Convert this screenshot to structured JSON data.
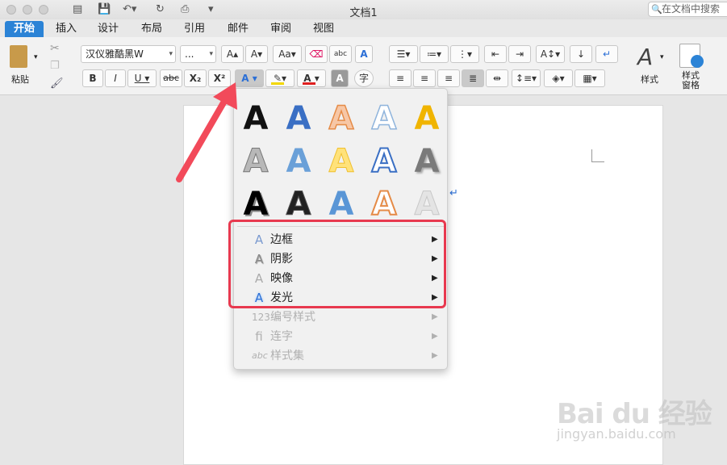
{
  "window": {
    "title": "文档1",
    "search_placeholder": "在文档中搜索"
  },
  "tabs": [
    "开始",
    "插入",
    "设计",
    "布局",
    "引用",
    "邮件",
    "审阅",
    "视图"
  ],
  "ribbon": {
    "paste_label": "粘贴",
    "font_name": "汉仪雅酷黑W",
    "font_size": "...",
    "bold": "B",
    "italic": "I",
    "underline": "U",
    "strikethrough": "abc",
    "subscript": "X₂",
    "superscript": "X²",
    "change_case": "Aa",
    "phonetic": "abc",
    "text_effects_icon": "A",
    "styles_label": "样式",
    "styles_pane_label": "样式\n窗格",
    "highlight_color": "#f5d800",
    "font_color": "#e02020",
    "accent": "#2b83d6"
  },
  "text_effects_menu": {
    "styles_grid_letter": "A",
    "items": [
      {
        "icon": "outline-icon",
        "label": "边框",
        "enabled": true
      },
      {
        "icon": "shadow-icon",
        "label": "阴影",
        "enabled": true
      },
      {
        "icon": "reflection-icon",
        "label": "映像",
        "enabled": true
      },
      {
        "icon": "glow-icon",
        "label": "发光",
        "enabled": true
      },
      {
        "icon": "number-style-icon",
        "label": "编号样式",
        "enabled": false
      },
      {
        "icon": "ligature-icon",
        "label": "连字",
        "enabled": false
      },
      {
        "icon": "stylistic-set-icon",
        "label": "样式集",
        "enabled": false
      }
    ],
    "highlight_border_color": "#e8394f"
  },
  "annotation": {
    "arrow_color": "#f24a5a"
  },
  "watermark": {
    "brand": "Bai du 经验",
    "url": "jingyan.baidu.com"
  }
}
